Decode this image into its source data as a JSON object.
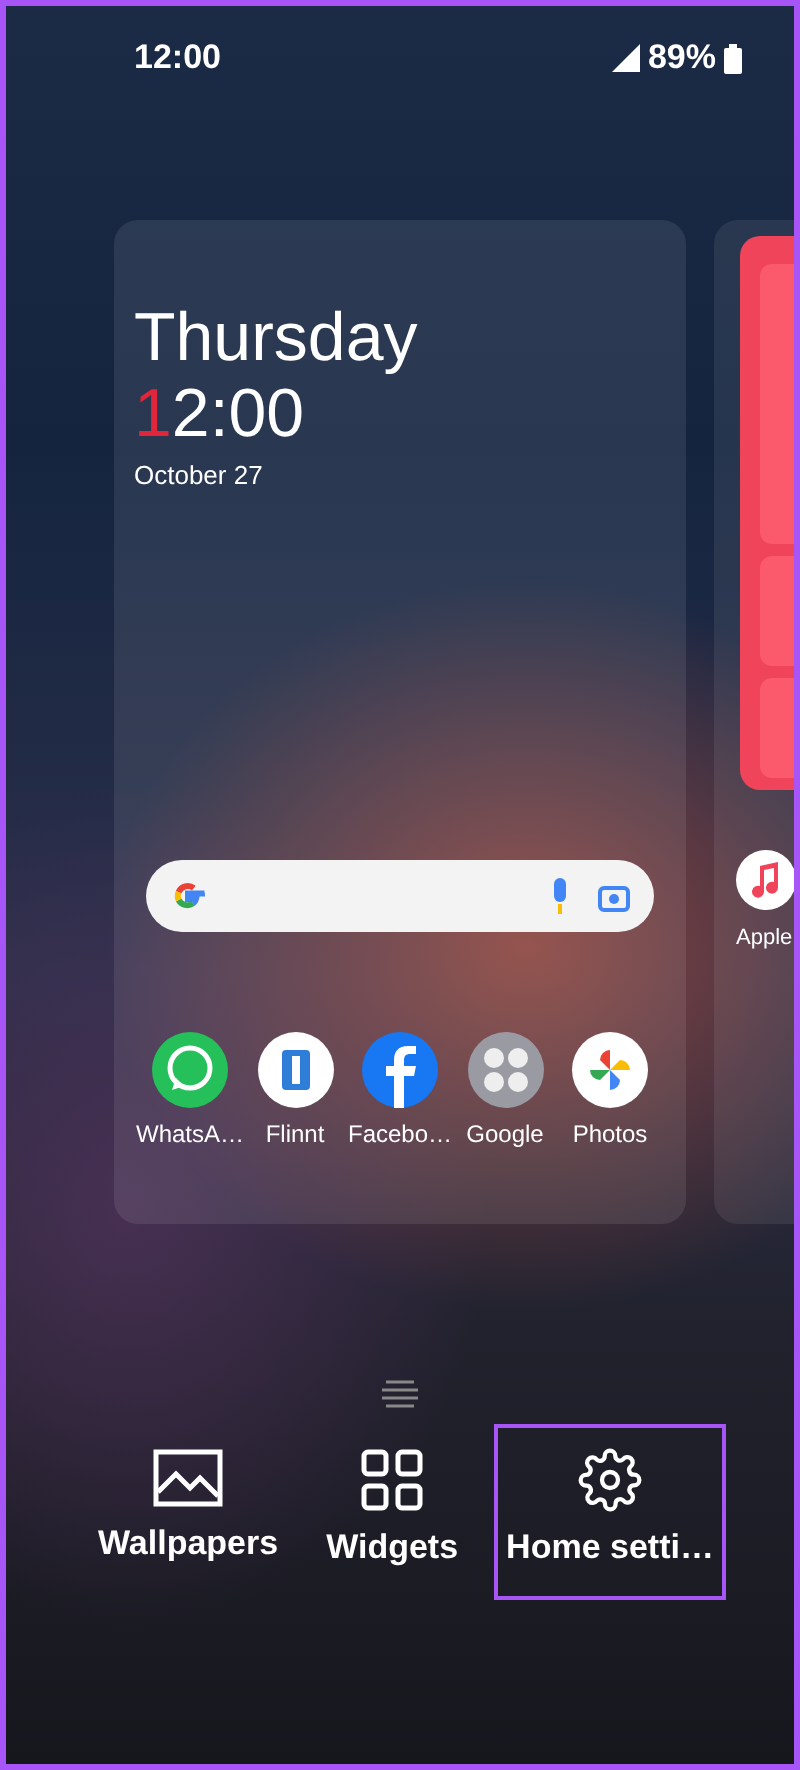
{
  "status_bar": {
    "time": "12:00",
    "battery": "89%"
  },
  "clock_widget": {
    "day": "Thursday",
    "time": "12:00",
    "date": "October 27"
  },
  "dock_apps": [
    {
      "label": "WhatsA…",
      "kind": "chat"
    },
    {
      "label": "Flinnt",
      "kind": "book"
    },
    {
      "label": "Facebo…",
      "kind": "social"
    },
    {
      "label": "Google",
      "kind": "folder"
    },
    {
      "label": "Photos",
      "kind": "photos"
    }
  ],
  "side_page": {
    "apps": [
      {
        "label": "Apple",
        "kind": "music"
      }
    ]
  },
  "edit_menu": [
    {
      "label": "Wallpapers",
      "kind": "wallpapers",
      "highlighted": false
    },
    {
      "label": "Widgets",
      "kind": "widgets",
      "highlighted": false
    },
    {
      "label": "Home setti…",
      "kind": "settings",
      "highlighted": true
    }
  ]
}
